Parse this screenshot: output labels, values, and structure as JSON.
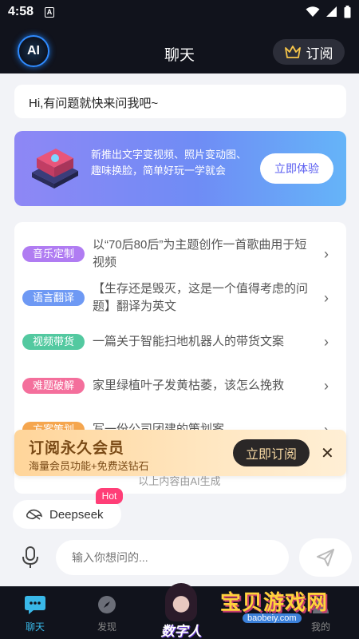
{
  "status_bar": {
    "time": "4:58",
    "badge": "A"
  },
  "header": {
    "logo": "AI",
    "title": "聊天",
    "subscribe_label": "订阅"
  },
  "greeting": "Hi,有问题就快来问我吧~",
  "banner": {
    "text": "新推出文字变视频、照片变动图、趣味换脸，简单好玩一学就会",
    "button": "立即体验"
  },
  "prompts": [
    {
      "tag": "音乐定制",
      "color": "#b07cf2",
      "text": "以“70后80后”为主题创作一首歌曲用于短视频"
    },
    {
      "tag": "语言翻译",
      "color": "#6e99f4",
      "text": "【生存还是毁灭，这是一个值得考虑的问题】翻译为英文"
    },
    {
      "tag": "视频带货",
      "color": "#53c9a0",
      "text": "一篇关于智能扫地机器人的带货文案"
    },
    {
      "tag": "难题破解",
      "color": "#f46f9c",
      "text": "家里绿植叶子发黄枯萎，该怎么挽救"
    },
    {
      "tag": "方案策划",
      "color": "#f5a64f",
      "text": "写一份公司团建的策划案"
    }
  ],
  "vip": {
    "title": "订阅永久会员",
    "subtitle": "海量会员功能+免费送钻石",
    "button": "立即订阅"
  },
  "footnote": "以上内容由AI生成",
  "model": {
    "name": "Deepseek",
    "badge": "Hot"
  },
  "input": {
    "placeholder": "输入你想问的..."
  },
  "tabs": {
    "chat": "聊天",
    "discover": "发现",
    "digital": "数字人",
    "mine": "我的"
  },
  "watermark": {
    "title": "宝贝游戏网",
    "url": "baobeiy.com"
  },
  "colors": {
    "accent": "#39b8e8",
    "dark": "#11131c",
    "gold": "#f7c64a"
  }
}
